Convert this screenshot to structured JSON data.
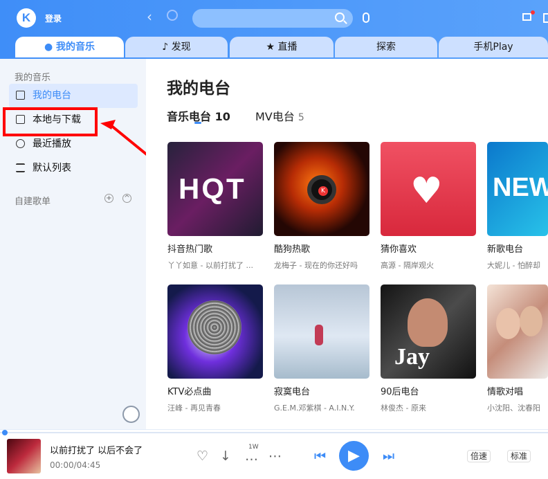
{
  "header": {
    "logo": "K",
    "login": "登录",
    "tabs": [
      "我的音乐",
      "发现",
      "直播",
      "探索",
      "手机Play"
    ]
  },
  "sidebar": {
    "section_my": "我的音乐",
    "items": [
      "我的电台",
      "本地与下载",
      "最近播放",
      "默认列表"
    ],
    "section_custom": "自建歌单"
  },
  "main": {
    "title": "我的电台",
    "subtabs": [
      {
        "label": "音乐电台",
        "count": "10"
      },
      {
        "label": "MV电台",
        "count": "5"
      }
    ],
    "cards": [
      {
        "title": "抖音热门歌",
        "sub": "丫丫如意 - 以前打扰了 ..."
      },
      {
        "title": "酷狗热歌",
        "sub": "龙梅子 - 现在的你还好吗"
      },
      {
        "title": "猜你喜欢",
        "sub": "高源 - 隔岸观火"
      },
      {
        "title": "新歌电台",
        "sub": "大妮儿 - 怕醉却"
      },
      {
        "title": "KTV必点曲",
        "sub": "汪峰 - 再见青春"
      },
      {
        "title": "寂寞电台",
        "sub": "G.E.M.邓紫棋 - A.I.N.Y."
      },
      {
        "title": "90后电台",
        "sub": "林俊杰 - 原来"
      },
      {
        "title": "情歌对唱",
        "sub": "小沈阳、沈春阳"
      }
    ],
    "cover_texts": {
      "hqt": "HQT",
      "kugou": "K",
      "new": "NEW",
      "jay": "Jay"
    }
  },
  "player": {
    "song": "以前打扰了 以后不会了",
    "time": "00:00/04:45",
    "play_count": "1W",
    "rate_label": "倍速",
    "quality_label": "标准"
  }
}
